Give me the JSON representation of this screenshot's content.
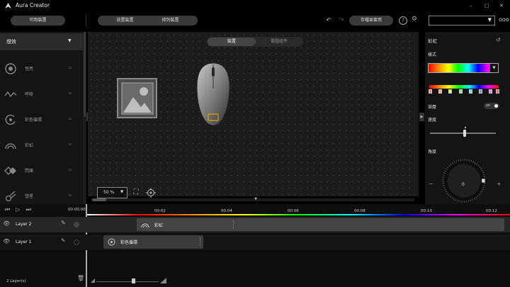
{
  "app": {
    "title": "Aura Creator"
  },
  "toolbar": {
    "available_devices": "可用裝置",
    "place_devices": "放置裝置",
    "arrange_devices": "排列裝置",
    "save_apply": "存檔並套用"
  },
  "canvas": {
    "tab_device": "裝置",
    "tab_components": "電腦組件",
    "zoom": "50 %"
  },
  "effects": {
    "header": "燈效",
    "items": [
      {
        "label": "恆亮"
      },
      {
        "label": "呼吸"
      },
      {
        "label": "彩色循環"
      },
      {
        "label": "彩虹"
      },
      {
        "label": "閃爍"
      },
      {
        "label": "彗星"
      }
    ]
  },
  "panel": {
    "title": "彩虹",
    "style_label": "樣式",
    "gradient_label": "漸層",
    "gradient_toggle": "on",
    "speed_label": "速度",
    "angle_label": "角度",
    "angle_value": "0",
    "minus": "−",
    "plus": "+"
  },
  "timeline": {
    "time": "00:00.00",
    "ticks": [
      "00:02",
      "00:04",
      "00:06",
      "00:08",
      "00:10",
      "00:12"
    ],
    "layers": [
      {
        "name": "Layer 2",
        "clip": "彩虹"
      },
      {
        "name": "Layer 1",
        "clip": "彩色循環"
      }
    ],
    "layer_count": "2 Layer(s)"
  },
  "colors": {
    "accent": "#ffffff",
    "bg": "#000000"
  }
}
